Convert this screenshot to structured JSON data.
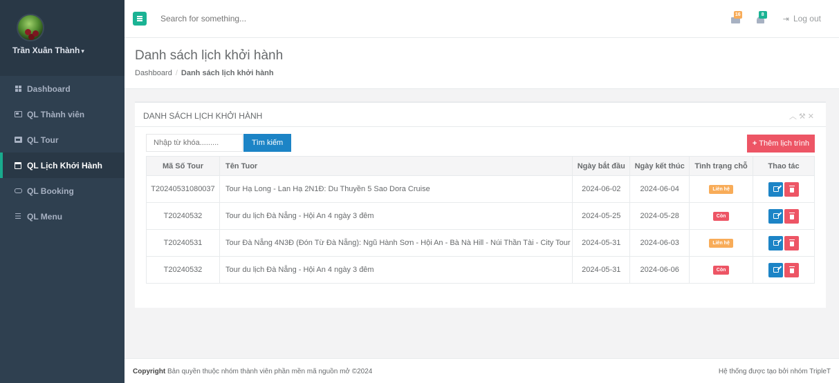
{
  "sidebar": {
    "user_name": "Trần Xuân Thành",
    "items": [
      {
        "label": "Dashboard",
        "icon": "th-large-icon",
        "active": false
      },
      {
        "label": "QL Thành viên",
        "icon": "id-card-icon",
        "active": false
      },
      {
        "label": "QL Tour",
        "icon": "image-icon",
        "active": false
      },
      {
        "label": "QL Lịch Khởi Hành",
        "icon": "calendar-icon",
        "active": true
      },
      {
        "label": "QL Booking",
        "icon": "hdd-icon",
        "active": false
      },
      {
        "label": "QL Menu",
        "icon": "sliders-icon",
        "active": false
      }
    ]
  },
  "topbar": {
    "search_placeholder": "Search for something...",
    "mail_count": "16",
    "bell_count": "8",
    "logout_label": "Log out"
  },
  "heading": {
    "title": "Danh sách lịch khởi hành",
    "breadcrumb_home": "Dashboard",
    "breadcrumb_current": "Danh sách lịch khởi hành"
  },
  "panel": {
    "title": "DANH SÁCH LỊCH KHỞI HÀNH",
    "keyword_placeholder": "Nhập từ khóa.........",
    "search_label": "Tìm kiếm",
    "add_label": "Thêm lịch trình",
    "columns": [
      "Mã Số Tour",
      "Tên Tuor",
      "Ngày bắt đầu",
      "Ngày kết thúc",
      "Tình trạng chỗ",
      "Thao tác"
    ],
    "rows": [
      {
        "code": "T20240531080037",
        "name": "Tour Hạ Long - Lan Hạ 2N1Đ: Du Thuyền 5 Sao Dora Cruise",
        "start": "2024-06-02",
        "end": "2024-06-04",
        "status": "Liên hệ",
        "status_type": "warning"
      },
      {
        "code": "T20240532",
        "name": "Tour du lịch Đà Nẵng - Hội An 4 ngày 3 đêm",
        "start": "2024-05-25",
        "end": "2024-05-28",
        "status": "Còn",
        "status_type": "danger"
      },
      {
        "code": "T20240531",
        "name": "Tour Đà Nẵng 4N3Đ (Đón Từ Đà Nẵng): Ngũ Hành Sơn - Hội An - Bà Nà Hill - Núi Thần Tài - City Tour",
        "start": "2024-05-31",
        "end": "2024-06-03",
        "status": "Liên hệ",
        "status_type": "warning"
      },
      {
        "code": "T20240532",
        "name": "Tour du lịch Đà Nẵng - Hội An 4 ngày 3 đêm",
        "start": "2024-05-31",
        "end": "2024-06-06",
        "status": "Còn",
        "status_type": "danger"
      }
    ]
  },
  "footer": {
    "copyright_bold": "Copyright",
    "copyright_text": "Bản quyền thuộc nhóm thành viên phần mền mã nguồn mở ©2024",
    "right_text": "Hệ thống được tạo bởi nhóm TripleT"
  },
  "colors": {
    "sidebar_bg": "#2f4050",
    "accent": "#1ab394",
    "primary": "#1c84c6",
    "danger": "#ed5565",
    "warning": "#f8ac59"
  }
}
